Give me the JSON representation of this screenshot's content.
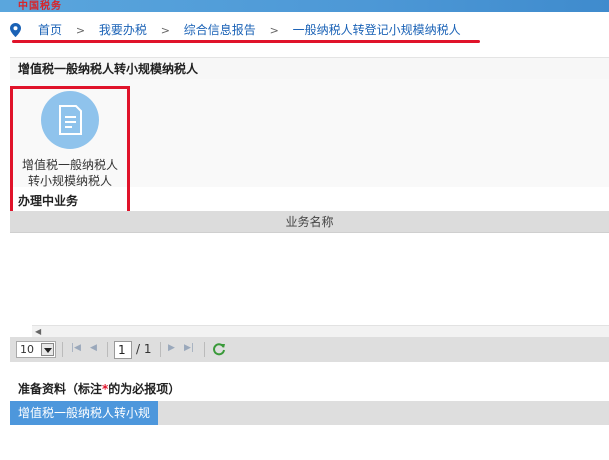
{
  "header": {
    "logo_text": "中国税务"
  },
  "breadcrumb": {
    "items": [
      "首页",
      "我要办税",
      "综合信息报告",
      "一般纳税人转登记小规模纳税人"
    ],
    "separator": ">"
  },
  "section_service": {
    "title": "增值税一般纳税人转小规模纳税人",
    "tile_label": "增值税一般纳税人转小规模纳税人"
  },
  "section_ongoing": {
    "title": "办理中业务",
    "column_header": "业务名称"
  },
  "pager": {
    "page_size": "10",
    "current_page": "1",
    "total_pages": "/ 1"
  },
  "section_prep": {
    "title_prefix": "准备资料（标注",
    "star": "*",
    "title_suffix": "的为必报项）",
    "tab_label": "增值税一般纳税人转小规"
  },
  "colors": {
    "highlight_red": "#e0132a",
    "link_blue": "#1a62b6",
    "tile_circle": "#8fc3ec",
    "tab_active": "#4d97dc"
  }
}
